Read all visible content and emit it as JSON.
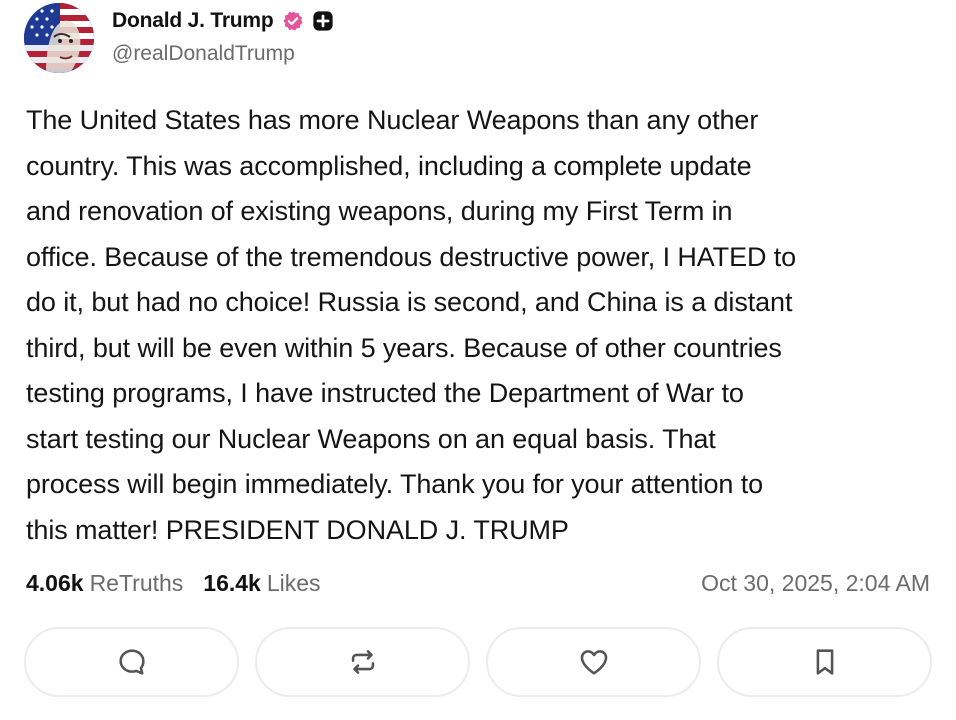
{
  "author": {
    "display_name": "Donald J. Trump",
    "handle": "@realDonaldTrump",
    "avatar_icon": "flag-portrait-avatar",
    "verified_icon": "verified-badge-icon",
    "verified_color": "#e4559b",
    "extra_badge_icon": "plus-badge-icon"
  },
  "post": {
    "text": "The United States has more Nuclear Weapons than any other\ncountry. This was accomplished, including a complete update\nand renovation of existing weapons, during my First Term in\noffice. Because of the tremendous destructive power, I HATED to\ndo it, but had no choice! Russia is second, and China is a distant\nthird, but will be even within 5 years. Because of other countries\ntesting programs, I have instructed the Department of War to\nstart testing our Nuclear Weapons on an equal basis. That\nprocess will begin immediately. Thank you for your attention to\nthis matter! PRESIDENT DONALD J. TRUMP"
  },
  "stats": {
    "retruths_count": "4.06k",
    "retruths_label": "ReTruths",
    "likes_count": "16.4k",
    "likes_label": "Likes",
    "timestamp": "Oct 30, 2025, 2:04 AM"
  },
  "actions": [
    {
      "icon": "reply-icon"
    },
    {
      "icon": "retruth-icon"
    },
    {
      "icon": "like-heart-icon"
    },
    {
      "icon": "bookmark-icon"
    }
  ],
  "colors": {
    "text": "#151515",
    "muted": "#6b6b6b",
    "button_border": "#ececec"
  }
}
